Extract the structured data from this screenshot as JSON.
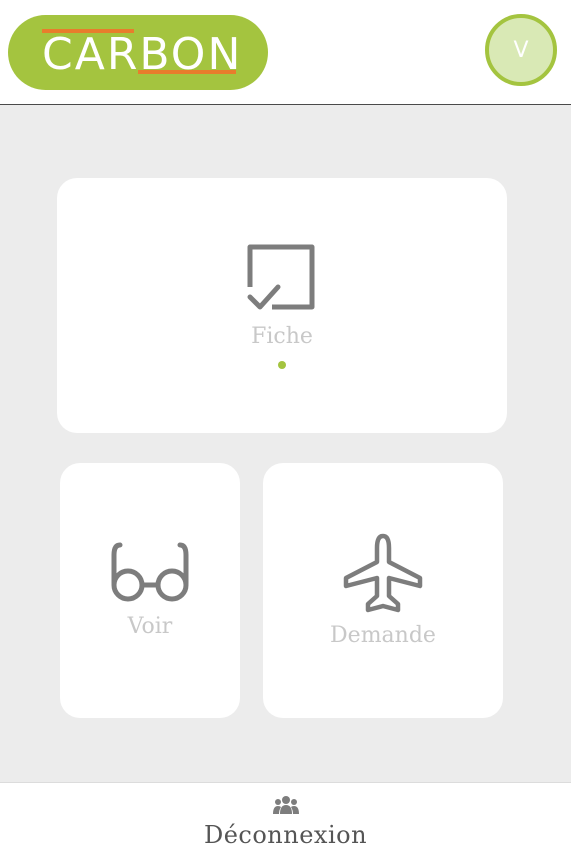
{
  "header": {
    "logo_text": "CARBON",
    "avatar_initial": "V"
  },
  "colors": {
    "brand_green": "#a4c43f",
    "brand_orange": "#e87d2c",
    "icon_gray": "#7d7d7d",
    "label_gray": "#c8c8c8",
    "background": "#ececec"
  },
  "menu": {
    "fiche": {
      "label": "Fiche",
      "icon": "checkbox-icon",
      "active": true
    },
    "voir": {
      "label": "Voir",
      "icon": "glasses-icon"
    },
    "demande": {
      "label": "Demande",
      "icon": "airplane-icon"
    }
  },
  "footer": {
    "label": "Déconnexion",
    "icon": "users-icon"
  }
}
